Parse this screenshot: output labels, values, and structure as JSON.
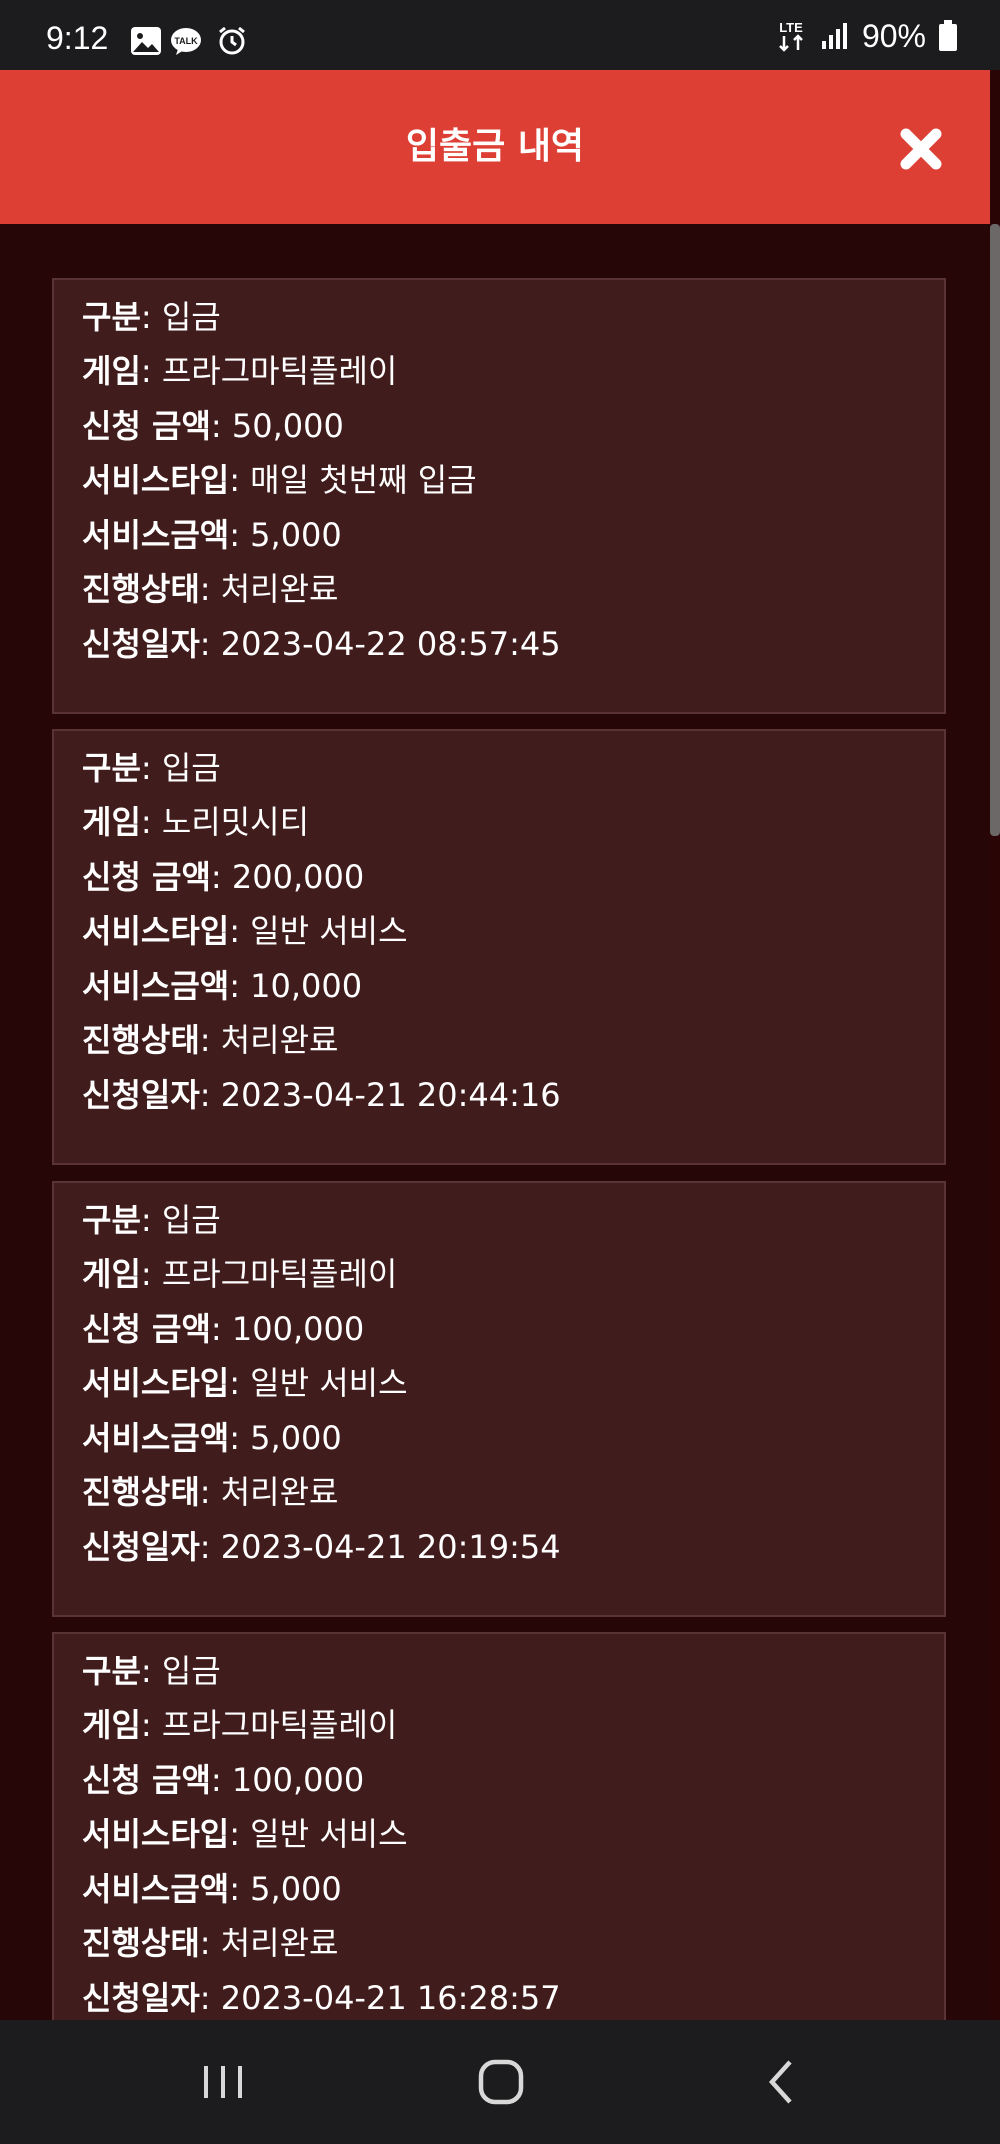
{
  "status_bar": {
    "time": "9:12",
    "network": "LTE",
    "battery": "90%",
    "icons": [
      "gallery-icon",
      "kakaotalk-icon",
      "alarm-icon",
      "lte-icon",
      "signal-icon",
      "battery-icon"
    ],
    "talk_text": "TALK"
  },
  "header": {
    "title": "입출금 내역",
    "close_icon": "close-icon",
    "color": "#dd3f35"
  },
  "labels": {
    "type": "구분",
    "game": "게임",
    "amount": "신청 금액",
    "service_type": "서비스타입",
    "service_amount": "서비스금액",
    "status": "진행상태",
    "date": "신청일자",
    "sep": ": "
  },
  "records": [
    {
      "type": "입금",
      "game": "프라그마틱플레이",
      "amount": "50,000",
      "service_type": "매일 첫번째 입금",
      "service_amount": "5,000",
      "status": "처리완료",
      "date": "2023-04-22 08:57:45"
    },
    {
      "type": "입금",
      "game": "노리밋시티",
      "amount": "200,000",
      "service_type": "일반 서비스",
      "service_amount": "10,000",
      "status": "처리완료",
      "date": "2023-04-21 20:44:16"
    },
    {
      "type": "입금",
      "game": "프라그마틱플레이",
      "amount": "100,000",
      "service_type": "일반 서비스",
      "service_amount": "5,000",
      "status": "처리완료",
      "date": "2023-04-21 20:19:54"
    },
    {
      "type": "입금",
      "game": "프라그마틱플레이",
      "amount": "100,000",
      "service_type": "일반 서비스",
      "service_amount": "5,000",
      "status": "처리완료",
      "date": "2023-04-21 16:28:57"
    }
  ],
  "nav_bar": {
    "buttons": [
      "recents-icon",
      "home-icon",
      "back-icon"
    ]
  }
}
